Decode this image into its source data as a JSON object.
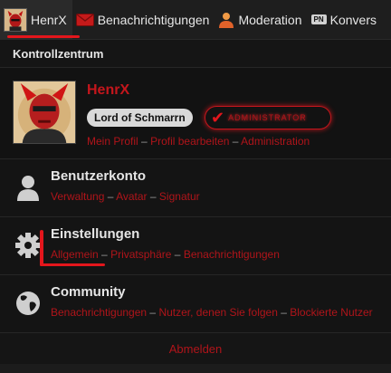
{
  "topbar": {
    "user_label": "HenrX",
    "notifications_label": "Benachrichtigungen",
    "moderation_label": "Moderation",
    "conversations_label": "Konvers",
    "pn_badge": "PN"
  },
  "panel": {
    "title": "Kontrollzentrum"
  },
  "profile": {
    "username": "HenrX",
    "rank": "Lord of Schmarrn",
    "admin_badge": "ADMINISTRATOR",
    "links": [
      "Mein Profil",
      "Profil bearbeiten",
      "Administration"
    ]
  },
  "sections": {
    "account": {
      "title": "Benutzerkonto",
      "links": [
        "Verwaltung",
        "Avatar",
        "Signatur"
      ]
    },
    "settings": {
      "title": "Einstellungen",
      "links": [
        "Allgemein",
        "Privatsphäre",
        "Benachrichtigungen"
      ]
    },
    "community": {
      "title": "Community",
      "links": [
        "Benachrichtigungen",
        "Nutzer, denen Sie folgen",
        "Blockierte Nutzer"
      ]
    }
  },
  "logout_label": "Abmelden",
  "separator": "–",
  "colors": {
    "accent": "#b0141a",
    "username": "#c4161c",
    "highlight_line": "#e3161c"
  }
}
